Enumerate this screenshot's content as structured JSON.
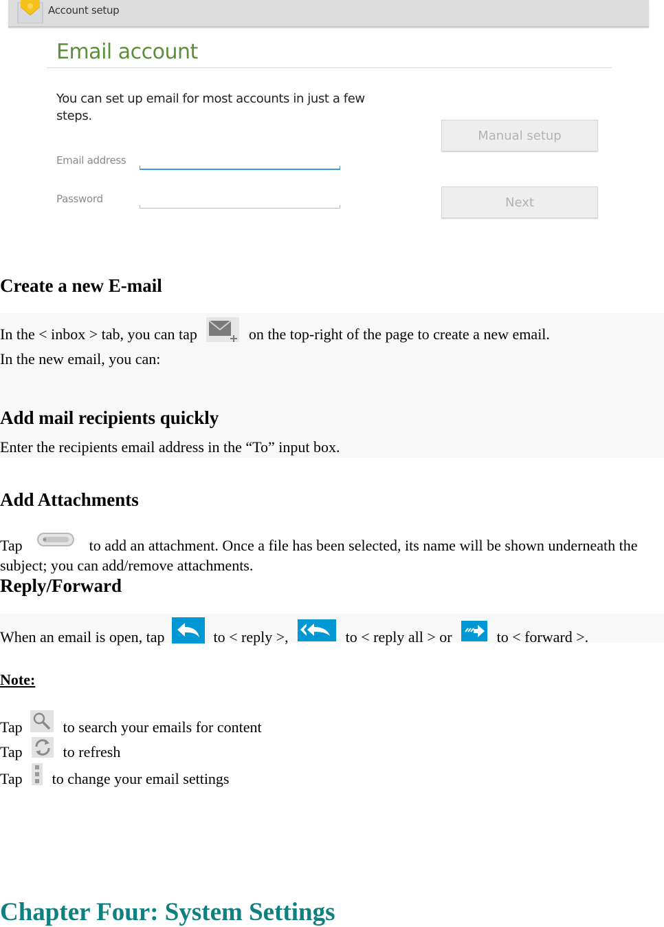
{
  "screenshot": {
    "action_bar": {
      "title": "Account setup",
      "icon": "email-app-icon"
    },
    "heading": "Email account",
    "intro": "You can set up email for most accounts in just a few steps.",
    "fields": [
      {
        "label": "Email address",
        "value": "",
        "focused": true
      },
      {
        "label": "Password",
        "value": "",
        "focused": false
      }
    ],
    "buttons": {
      "manual_setup": "Manual setup",
      "next": "Next"
    },
    "colors": {
      "heading": "#5c8f3a",
      "focus_line": "#3d9ad6",
      "button_text_disabled": "#b3b3b3"
    }
  },
  "sections": {
    "create": {
      "title": "Create a new E-mail",
      "line1_before": "In the < inbox > tab, you can tap",
      "line1_icon": "compose-mail-icon",
      "line1_after": "on the top-right of the page to create a new email.",
      "line2": "In the new email, you can:"
    },
    "recipients": {
      "title": "Add mail recipients quickly",
      "body": "Enter the recipients email address in the “To” input box."
    },
    "attachments": {
      "title": "Add Attachments",
      "tap": "Tap",
      "icon": "attachment-icon",
      "line1_after": "to add an attachment. Once a file has been selected, its name will be shown underneath the",
      "line2": "subject; you can add/remove attachments."
    },
    "reply": {
      "title": "Reply/Forward",
      "part1": "When an email is open, tap",
      "part2": "to < reply >,",
      "part3": "to < reply all > or",
      "part4": "to < forward >.",
      "icons": [
        "reply-icon",
        "reply-all-icon",
        "forward-icon"
      ],
      "icon_color": "#0098d4"
    },
    "note": {
      "title": "Note:",
      "items": [
        {
          "tap": "Tap",
          "icon": "search-icon",
          "text": "to search your emails for content"
        },
        {
          "tap": "Tap",
          "icon": "refresh-icon",
          "text": "to refresh"
        },
        {
          "tap": "Tap",
          "icon": "overflow-menu-icon",
          "text": "to change your email settings"
        }
      ]
    }
  },
  "chapter": {
    "title": "Chapter Four: System Settings",
    "color": "#0f8080"
  }
}
